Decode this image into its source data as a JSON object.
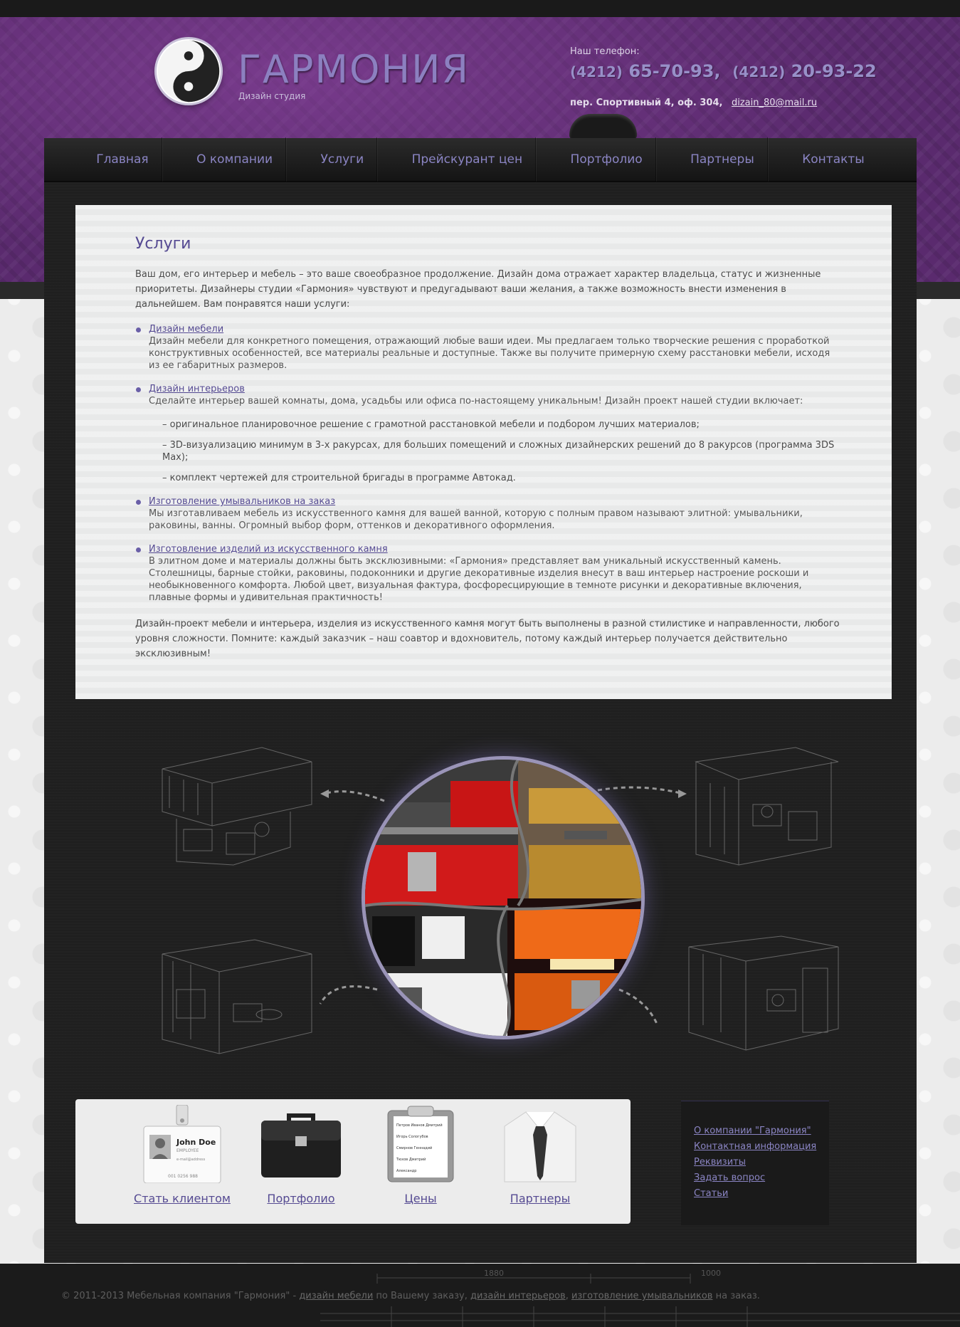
{
  "brand": {
    "title": "ГАРМОНИЯ",
    "subtitle": "Дизайн студия"
  },
  "contact": {
    "phone_label": "Наш телефон:",
    "phone1_code": "(4212)",
    "phone1_number": "65-70-93,",
    "phone2_code": "(4212)",
    "phone2_number": "20-93-22",
    "address": "пер. Спортивный 4, оф. 304,",
    "email": "dizain_80@mail.ru"
  },
  "nav": {
    "items": [
      "Главная",
      "О компании",
      "Услуги",
      "Прейскурант цен",
      "Портфолио",
      "Партнеры",
      "Контакты"
    ]
  },
  "content": {
    "title": "Услуги",
    "intro": "Ваш дом, его интерьер и мебель – это ваше своеобразное продолжение. Дизайн дома отражает характер владельца, статус и жизненные приоритеты. Дизайнеры студии «Гармония» чувствуют и предугадывают ваши желания, а также возможность внести изменения в дальнейшем. Вам понравятся наши услуги:",
    "services": [
      {
        "link": "Дизайн мебели",
        "text": "Дизайн мебели для конкретного помещения, отражающий любые ваши идеи. Мы предлагаем только творческие решения с проработкой конструктивных особенностей, все материалы реальные и доступные. Также вы получите примерную схему расстановки мебели, исходя из ее габаритных размеров."
      },
      {
        "link": "Дизайн интерьеров",
        "text": "Сделайте интерьер вашей комнаты, дома, усадьбы или офиса по-настоящему уникальным! Дизайн проект нашей студии включает:",
        "sub": [
          "– оригинальное планировочное решение с грамотной расстановкой мебели и подбором лучших материалов;",
          "– 3D-визуализацию минимум в 3-х ракурсах, для больших помещений и сложных дизайнерских решений до 8 ракурсов (программа 3DS Max);",
          "– комплект чертежей для строительной бригады в программе Автокад."
        ]
      },
      {
        "link": "Изготовление умывальников на заказ",
        "text": "Мы изготавливаем мебель из искусственного камня для вашей ванной, которую с полным правом называют элитной: умывальники, раковины, ванны. Огромный выбор форм, оттенков и декоративного оформления."
      },
      {
        "link": "Изготовление изделий из искусственного камня",
        "text": "В элитном доме и материалы должны быть эксклюзивными: «Гармония» представляет вам уникальный искусственный камень. Столешницы, барные стойки, раковины, подоконники и другие декоративные изделия внесут в ваш интерьер настроение роскоши и необыкновенного комфорта. Любой цвет, визуальная фактура, фосфоресцирующие в темноте рисунки и декоративные включения, плавные формы и удивительная практичность!"
      }
    ],
    "outro": "Дизайн-проект мебели и интерьера, изделия из искусственного камня могут быть выполнены в разной стилистике и направленности, любого уровня сложности. Помните: каждый заказчик – наш соавтор и вдохновитель, потому каждый интерьер получается действительно эксклюзивным!"
  },
  "badge": {
    "name": "John Doe",
    "role": "EMPLOYEE",
    "email": "e-mail@address",
    "number": "001 0256 988"
  },
  "clipboard_lines": [
    "Петров Иванов Дмитрий",
    "Игорь Сологубов",
    "Смирнов Геннадий",
    "Тюхов Дмитрий",
    "Александр"
  ],
  "tiles": [
    "Стать клиентом",
    "Портфолио",
    "Цены",
    "Партнеры"
  ],
  "side_links": [
    "О компании \"Гармония\"",
    "Контактная информация",
    "Реквизиты",
    "Задать вопрос",
    "Статьи"
  ],
  "footer": {
    "prefix": "© 2011-2013 Мебельная компания \"Гармония\" - ",
    "link1": "дизайн мебели",
    "mid1": " по Вашему заказу, ",
    "link2": "дизайн интерьеров",
    "mid2": ", ",
    "link3": "изготовление умывальников",
    "suffix": " на заказ.",
    "dim1": "1880",
    "dim2": "1000"
  },
  "colors": {
    "header_purple": "#5a2a6e",
    "accent": "#8b85c4",
    "link": "#554a92",
    "panel_dark": "#1f1f1f"
  }
}
